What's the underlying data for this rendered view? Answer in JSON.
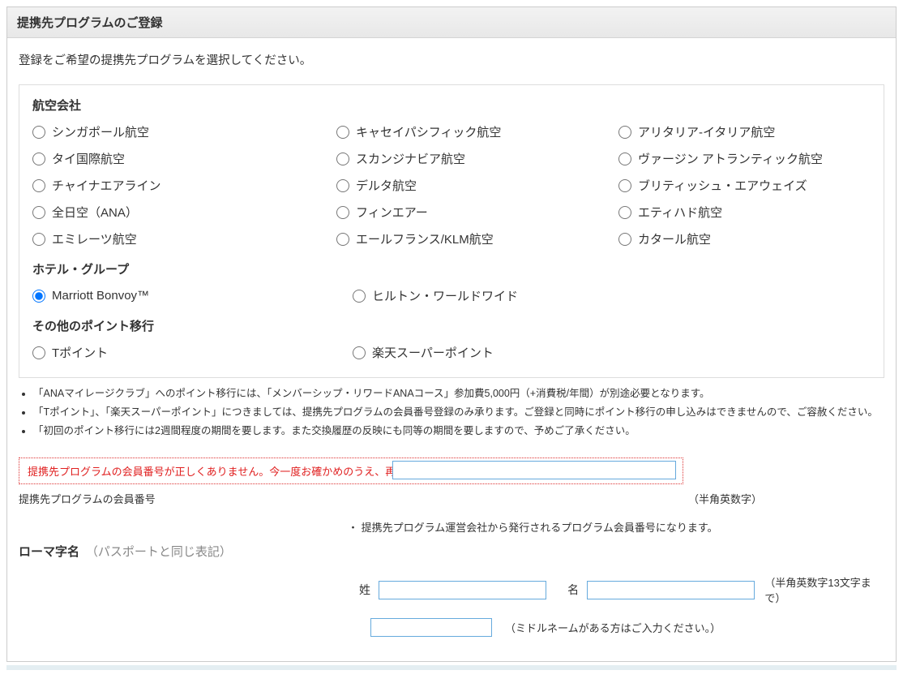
{
  "header": {
    "title": "提携先プログラムのご登録"
  },
  "intro": "登録をご希望の提携先プログラムを選択してください。",
  "groups": {
    "airlines": {
      "title": "航空会社",
      "items": [
        "シンガポール航空",
        "キャセイパシフィック航空",
        "アリタリア-イタリア航空",
        "タイ国際航空",
        "スカンジナビア航空",
        "ヴァージン アトランティック航空",
        "チャイナエアライン",
        "デルタ航空",
        "ブリティッシュ・エアウェイズ",
        "全日空（ANA）",
        "フィンエアー",
        "エティハド航空",
        "エミレーツ航空",
        "エールフランス/KLM航空",
        "カタール航空"
      ]
    },
    "hotels": {
      "title": "ホテル・グループ",
      "items": [
        "Marriott Bonvoy™",
        "ヒルトン・ワールドワイド"
      ],
      "selectedIndex": 0
    },
    "other": {
      "title": "その他のポイント移行",
      "items": [
        "Tポイント",
        "楽天スーパーポイント"
      ]
    }
  },
  "notes": [
    "「ANAマイレージクラブ」へのポイント移行には、「メンバーシップ・リワードANAコース」参加費5,000円（+消費税/年間）が別途必要となります。",
    "「Tポイント」、「楽天スーパーポイント」につきましては、提携先プログラムの会員番号登録のみ承ります。ご登録と同時にポイント移行の申し込みはできませんので、ご容赦ください。",
    "「初回のポイント移行には2週間程度の期間を要します。また交換履歴の反映にも同等の期間を要しますので、予めご了承ください。"
  ],
  "error": "提携先プログラムの会員番号が正しくありません。今一度お確かめのうえ、再度ご入力ください。",
  "memberNumber": {
    "label": "提携先プログラムの会員番号",
    "hint": "（半角英数字）",
    "subhint": "・ 提携先プログラム運営会社から発行されるプログラム会員番号になります。",
    "value": ""
  },
  "romaji": {
    "title": "ローマ字名",
    "subtitle": "（パスポートと同じ表記）",
    "lastNameLabel": "姓",
    "firstNameLabel": "名",
    "hint": "（半角英数字13文字まで）",
    "middleHint": "（ミドルネームがある方はご入力ください。）",
    "lastNameValue": "",
    "firstNameValue": "",
    "middleNameValue": ""
  }
}
